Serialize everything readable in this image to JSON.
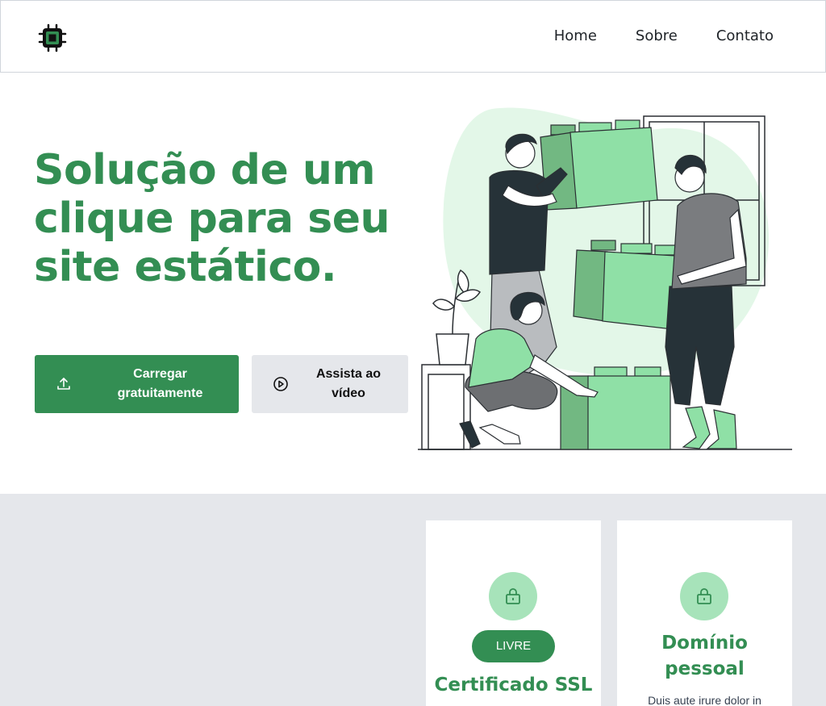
{
  "header": {
    "logo_icon": "chip-icon",
    "nav": [
      "Home",
      "Sobre",
      "Contato"
    ]
  },
  "hero": {
    "title": "Solução de um clique para seu site estático.",
    "primary_button": {
      "label": "Carregar gratuitamente",
      "icon": "upload-icon"
    },
    "secondary_button": {
      "label": "Assista ao vídeo",
      "icon": "play-circle-icon"
    },
    "illustration": "people-stacking-green-boxes-illustration"
  },
  "features": [
    {
      "icon": "lock-icon",
      "badge": "LIVRE",
      "title": "Certificado SSL"
    },
    {
      "icon": "lock-icon",
      "title": "Domínio pessoal",
      "text": "Duis aute irure dolor in"
    }
  ],
  "colors": {
    "brand": "#338e53",
    "brand_light": "#a7e3ba",
    "box_green": "#8fe0a6",
    "band_gray": "#e5e7eb"
  }
}
